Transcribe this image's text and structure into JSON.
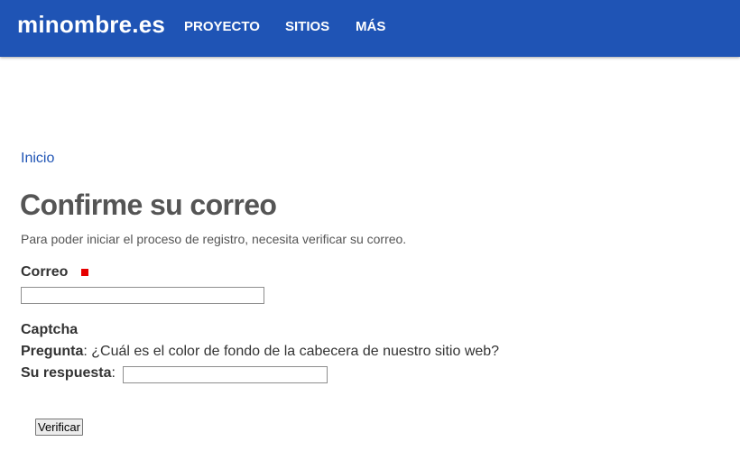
{
  "header": {
    "brand": "minombre.es",
    "nav": [
      {
        "label": "PROYECTO"
      },
      {
        "label": "SITIOS"
      },
      {
        "label": "MÁS"
      }
    ],
    "background_color": "#1f54b5"
  },
  "breadcrumb": {
    "home_label": "Inicio"
  },
  "page": {
    "title": "Confirme su correo",
    "intro": "Para poder iniciar el proceso de registro, necesita verificar su correo."
  },
  "form": {
    "email_label": "Correo",
    "email_value": "",
    "required_color": "#e60000",
    "captcha_title": "Captcha",
    "question_label": "Pregunta",
    "question_text": ": ¿Cuál es el color de fondo de la cabecera de nuestro sitio web?",
    "answer_label": "Su respuesta",
    "answer_sep": ":",
    "answer_value": "",
    "submit_label": "Verificar"
  }
}
